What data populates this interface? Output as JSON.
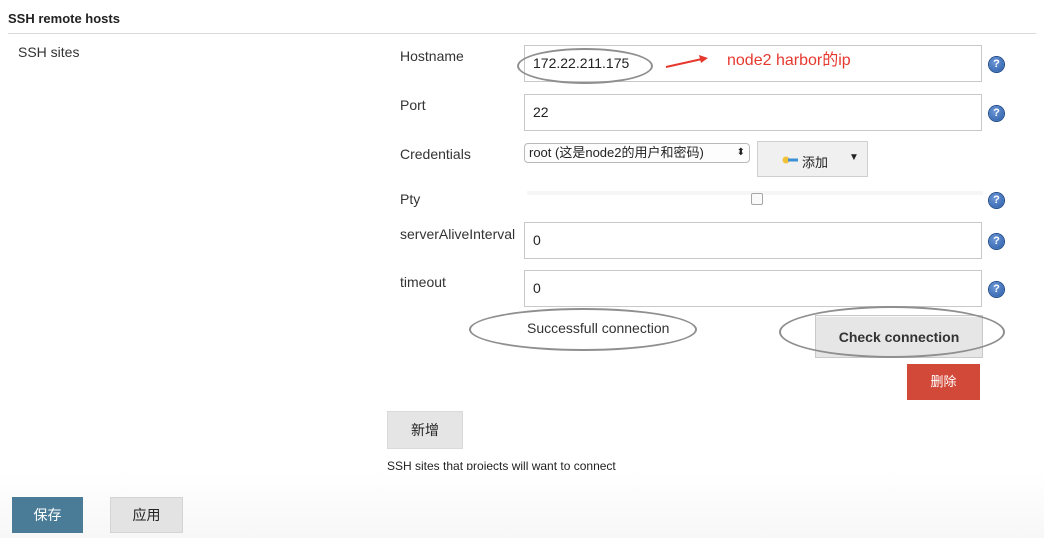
{
  "section": {
    "title": "SSH remote hosts"
  },
  "sites": {
    "label": "SSH sites",
    "hostname": {
      "label": "Hostname",
      "value": "172.22.211.175"
    },
    "port": {
      "label": "Port",
      "value": "22"
    },
    "credentials": {
      "label": "Credentials",
      "selected": "root (这是node2的用户和密码)",
      "add_label": "添加"
    },
    "pty": {
      "label": "Pty",
      "checked": false
    },
    "server_alive_interval": {
      "label": "serverAliveInterval",
      "value": "0"
    },
    "timeout": {
      "label": "timeout",
      "value": "0"
    },
    "connection_status": "Successfull connection",
    "check_connection_label": "Check connection",
    "delete_label": "删除",
    "new_label": "新增",
    "description": "SSH sites that projects will want to connect"
  },
  "annotation": {
    "text": "node2 harbor的ip",
    "color": "#e6392e"
  },
  "footer": {
    "save_label": "保存",
    "apply_label": "应用"
  },
  "colors": {
    "save": "#4a7c98",
    "delete": "#d24939",
    "help": "#285ba6"
  }
}
